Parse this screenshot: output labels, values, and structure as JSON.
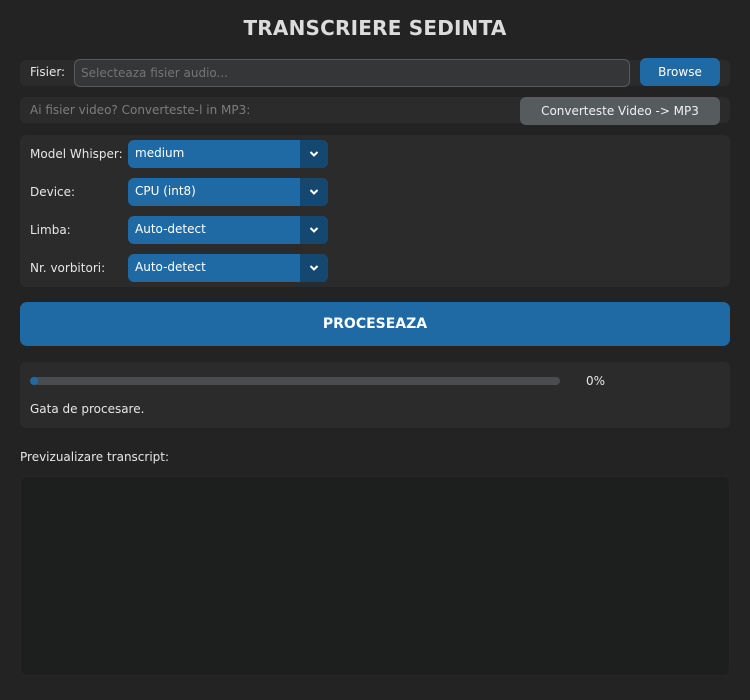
{
  "app": {
    "title": "TRANSCRIERE SEDINTA"
  },
  "file": {
    "label": "Fisier:",
    "placeholder": "Selecteaza fisier audio...",
    "browse_label": "Browse"
  },
  "convert": {
    "hint": "Ai fisier video? Converteste-l in MP3:",
    "button_label": "Converteste Video -> MP3"
  },
  "settings": {
    "model": {
      "label": "Model Whisper:",
      "value": "medium"
    },
    "device": {
      "label": "Device:",
      "value": "CPU (int8)"
    },
    "language": {
      "label": "Limba:",
      "value": "Auto-detect"
    },
    "speakers": {
      "label": "Nr. vorbitori:",
      "value": "Auto-detect"
    }
  },
  "process_label": "PROCESEAZA",
  "progress": {
    "value": 0,
    "percent_text": "0%",
    "status": "Gata de procesare."
  },
  "preview": {
    "label": "Previzualizare transcript:"
  },
  "colors": {
    "accent": "#1f6aa5",
    "accent_dark": "#144870",
    "background": "#232323",
    "panel": "#2b2b2b",
    "secondary_button": "#565b5e"
  },
  "icons": {
    "dropdown": "chevron-down-icon"
  }
}
